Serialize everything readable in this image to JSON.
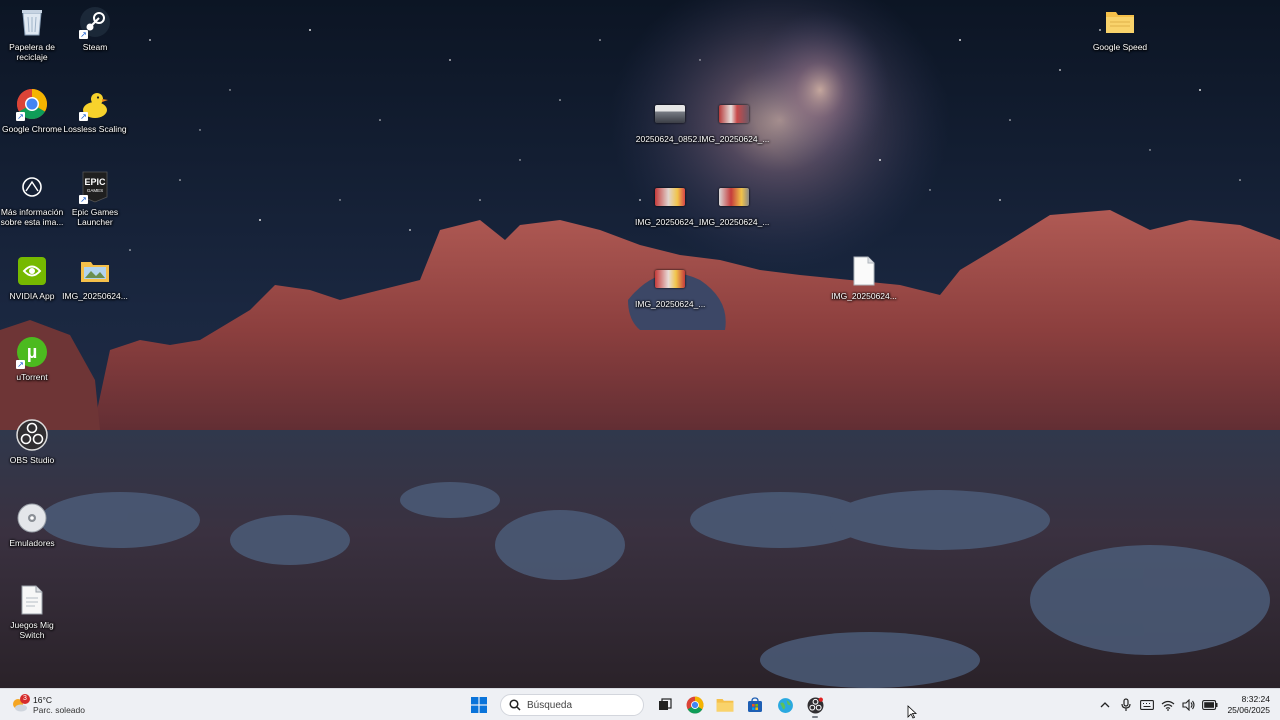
{
  "desktop": {
    "icons": [
      {
        "label": "Papelera de reciclaje",
        "icon": "recycle-bin-icon"
      },
      {
        "label": "Steam",
        "icon": "steam-icon"
      },
      {
        "label": "Google Speed",
        "icon": "folder-icon"
      },
      {
        "label": "Google Chrome",
        "icon": "chrome-icon"
      },
      {
        "label": "Lossless Scaling",
        "icon": "duck-icon"
      },
      {
        "label": "Más información sobre esta ima...",
        "icon": "info-camera-icon"
      },
      {
        "label": "Epic Games Launcher",
        "icon": "epic-games-icon"
      },
      {
        "label": "NVIDIA App",
        "icon": "nvidia-icon"
      },
      {
        "label": "IMG_20250624...",
        "icon": "image-thumbnail-icon"
      },
      {
        "label": "uTorrent",
        "icon": "utorrent-icon"
      },
      {
        "label": "OBS Studio",
        "icon": "obs-icon"
      },
      {
        "label": "Emuladores",
        "icon": "disc-icon"
      },
      {
        "label": "Juegos Mig Switch",
        "icon": "document-icon"
      },
      {
        "label": "20250624_0852...",
        "icon": "image-thumbnail-icon"
      },
      {
        "label": "IMG_20250624_...",
        "icon": "image-thumbnail-icon"
      },
      {
        "label": "IMG_20250624_...",
        "icon": "image-thumbnail-icon"
      },
      {
        "label": "IMG_20250624_...",
        "icon": "image-thumbnail-icon"
      },
      {
        "label": "IMG_20250624_...",
        "icon": "image-thumbnail-icon"
      },
      {
        "label": "IMG_20250624...",
        "icon": "document-icon"
      }
    ]
  },
  "taskbar": {
    "weather": {
      "temp": "16°C",
      "condition": "Parc. soleado",
      "badge": "3"
    },
    "search_placeholder": "Búsqueda",
    "apps": [
      "start-icon",
      "task-view-icon",
      "chrome-icon",
      "file-explorer-icon",
      "store-icon",
      "globe-app-icon",
      "obs-icon"
    ],
    "tray_icons": [
      "chevron-up-icon",
      "microphone-icon",
      "keyboard-icon",
      "wifi-icon",
      "volume-icon",
      "battery-icon"
    ],
    "clock": {
      "time": "8:32:24",
      "date": "25/06/2025"
    }
  },
  "colors": {
    "taskbar_bg": "#eef0f4",
    "accent": "#0067c0"
  }
}
